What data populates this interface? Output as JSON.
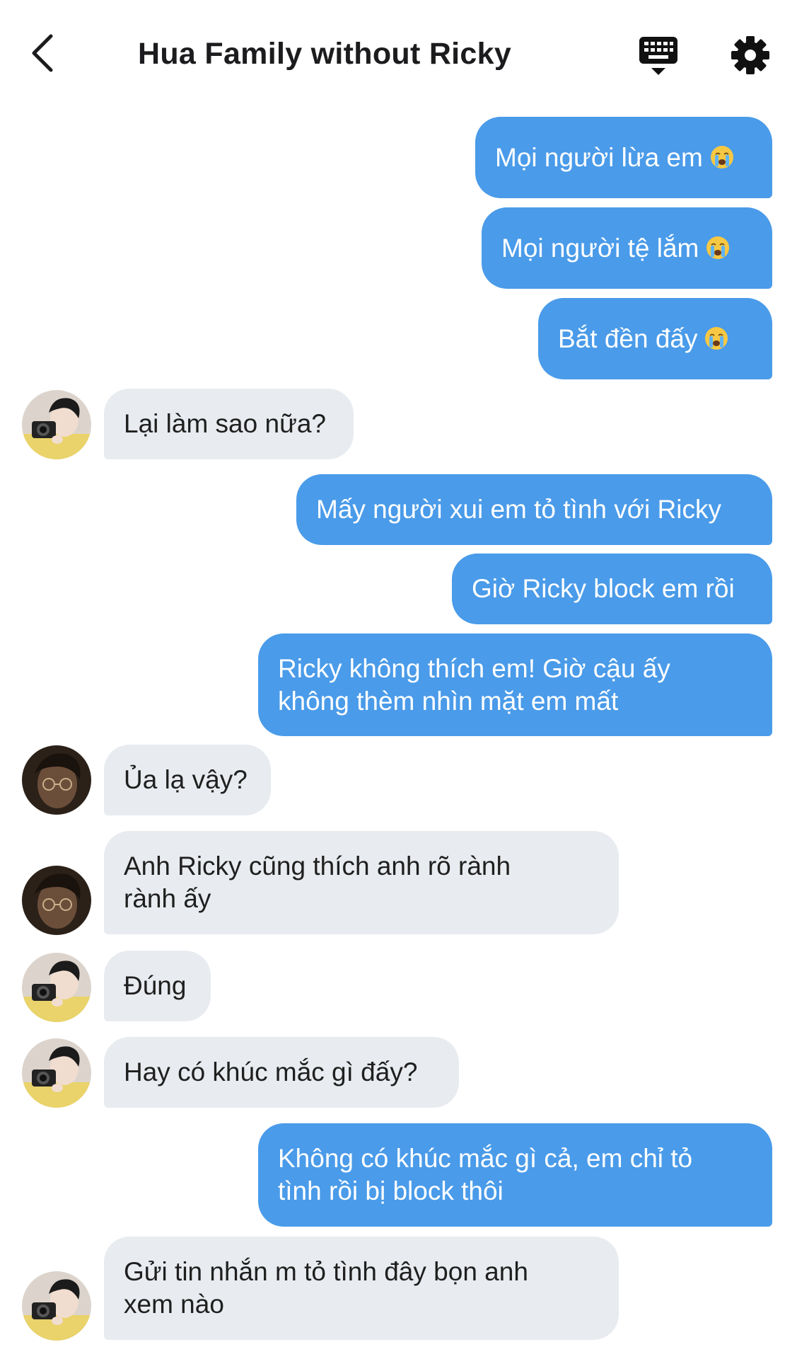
{
  "header": {
    "title": "Hua Family without Ricky"
  },
  "messages": [
    {
      "side": "out",
      "text": "Mọi người lừa em",
      "emoji": "loudly-crying-face-icon"
    },
    {
      "side": "out",
      "text": "Mọi người tệ lắm",
      "emoji": "loudly-crying-face-icon"
    },
    {
      "side": "out",
      "text": "Bắt đền đấy",
      "emoji": "loudly-crying-face-icon"
    },
    {
      "side": "in",
      "text": "Lại làm sao nữa?",
      "avatar": "avatar-camera-boy"
    },
    {
      "side": "out",
      "text": "Mấy người xui em tỏ tình với Ricky"
    },
    {
      "side": "out",
      "text": "Giờ Ricky block em rồi"
    },
    {
      "side": "out",
      "text": "Ricky không thích em! Giờ cậu ấy\nkhông thèm nhìn mặt em mất"
    },
    {
      "side": "in",
      "text": "Ủa lạ vậy?",
      "avatar": "avatar-glasses-boy"
    },
    {
      "side": "in",
      "text": "Anh Ricky cũng thích anh rõ rành\nrành ấy",
      "avatar": "avatar-glasses-boy"
    },
    {
      "side": "in",
      "text": "Đúng",
      "avatar": "avatar-camera-boy"
    },
    {
      "side": "in",
      "text": "Hay có khúc mắc gì đấy?",
      "avatar": "avatar-camera-boy"
    },
    {
      "side": "out",
      "text": "Không có khúc mắc gì cả, em chỉ tỏ\ntình rồi bị block thôi"
    },
    {
      "side": "in",
      "text": "Gửi tin nhắn m tỏ tình đây bọn anh\nxem nào",
      "avatar": "avatar-camera-boy"
    }
  ],
  "colors": {
    "outgoing_bubble": "#4a9be9",
    "incoming_bubble": "#e8ebef",
    "title": "#1c1c1e"
  }
}
